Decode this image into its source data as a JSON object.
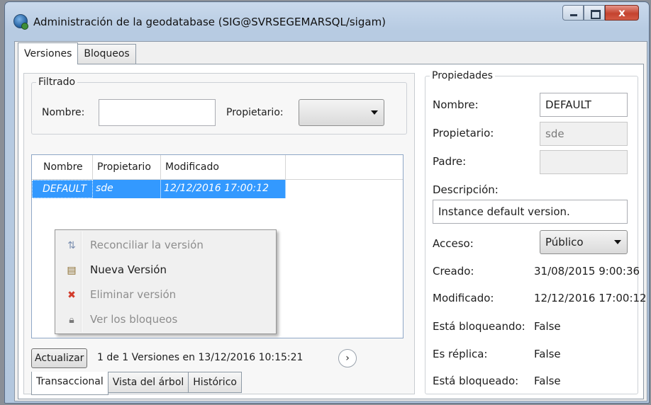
{
  "window": {
    "title": "Administración de la geodatabase (SIG@SVRSEGEMARSQL/sigam)",
    "close_glyph": "x"
  },
  "tabs": [
    "Versiones",
    "Bloqueos"
  ],
  "filter": {
    "legend": "Filtrado",
    "name_label": "Nombre:",
    "name_value": "",
    "owner_label": "Propietario:",
    "owner_value": ""
  },
  "grid": {
    "columns": [
      "Nombre",
      "Propietario",
      "Modificado"
    ],
    "rows": [
      {
        "name": "DEFAULT",
        "owner": "sde",
        "modified": "12/12/2016 17:00:12"
      }
    ]
  },
  "context_menu": [
    {
      "label": "Reconciliar la versión",
      "icon": "reconcile-icon",
      "enabled": false
    },
    {
      "label": "Nueva Versión",
      "icon": "new-version-icon",
      "enabled": true
    },
    {
      "label": "Eliminar versión",
      "icon": "delete-icon",
      "enabled": false
    },
    {
      "label": "Ver los bloqueos",
      "icon": "lock-icon",
      "enabled": false
    }
  ],
  "bottom": {
    "refresh_label": "Actualizar",
    "status": "1 de 1 Versiones en 13/12/2016 10:15:21",
    "next_glyph": "›"
  },
  "view_tabs": [
    "Transaccional",
    "Vista del árbol",
    "Histórico"
  ],
  "properties": {
    "legend": "Propiedades",
    "name_label": "Nombre:",
    "name_value": "DEFAULT",
    "owner_label": "Propietario:",
    "owner_value": "sde",
    "parent_label": "Padre:",
    "parent_value": "",
    "description_label": "Descripción:",
    "description_value": "Instance default version.",
    "access_label": "Acceso:",
    "access_value": "Público",
    "created_label": "Creado:",
    "created_value": "31/08/2015 9:00:36",
    "modified_label": "Modificado:",
    "modified_value": "12/12/2016 17:00:12",
    "locking_label": "Está bloqueando:",
    "locking_value": "False",
    "replica_label": "Es réplica:",
    "replica_value": "False",
    "locked_label": "Está bloqueado:",
    "locked_value": "False"
  }
}
